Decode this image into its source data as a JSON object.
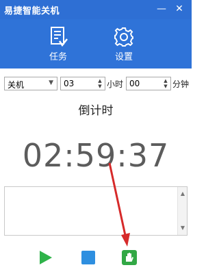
{
  "window": {
    "title": "易捷智能关机",
    "minimize_label": "—",
    "close_label": "✕"
  },
  "nav": {
    "task_label": "任务",
    "settings_label": "设置"
  },
  "controls": {
    "action_selected": "关机",
    "hour_value": "03",
    "hour_unit": "小时",
    "minute_value": "00",
    "minute_unit": "分钟"
  },
  "countdown": {
    "title": "倒计时",
    "time": "02:59:37"
  },
  "log": {
    "content": ""
  },
  "toolbar": {
    "start": "play-icon",
    "stop": "stop-icon",
    "hide": "hand-icon"
  },
  "colors": {
    "titlebar": "#2e6fd4",
    "nav": "#2f73d8",
    "play": "#2fb34a",
    "stop": "#2e8fe0",
    "hand": "#32a845",
    "annotation_arrow": "#d62a2a"
  }
}
